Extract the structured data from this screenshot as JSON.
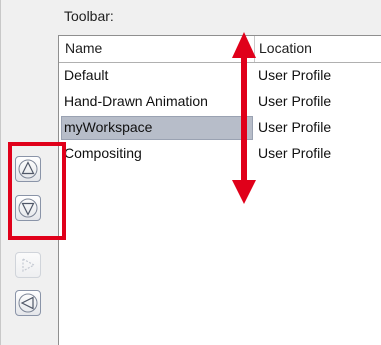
{
  "toolbar_section": {
    "label": "Toolbar:"
  },
  "list": {
    "columns": [
      "Name",
      "Location"
    ],
    "rows": [
      {
        "name": "Default",
        "location": "User Profile",
        "selected": false
      },
      {
        "name": "Hand-Drawn Animation",
        "location": "User Profile",
        "selected": false
      },
      {
        "name": "myWorkspace",
        "location": "User Profile",
        "selected": true
      },
      {
        "name": "Compositing",
        "location": "User Profile",
        "selected": false
      }
    ]
  },
  "buttons": {
    "move_up": {
      "icon": "triangle-up-icon",
      "enabled": true
    },
    "move_down": {
      "icon": "triangle-down-icon",
      "enabled": true
    },
    "add_right": {
      "icon": "triangle-right-icon",
      "enabled": false
    },
    "remove_left": {
      "icon": "triangle-left-icon",
      "enabled": true
    }
  },
  "annotations": {
    "highlight_color": "#e0001a",
    "double_arrow_color": "#e0001a"
  },
  "colors": {
    "selection": "#b7bdc9",
    "panel_bg": "#f0f0f0"
  }
}
